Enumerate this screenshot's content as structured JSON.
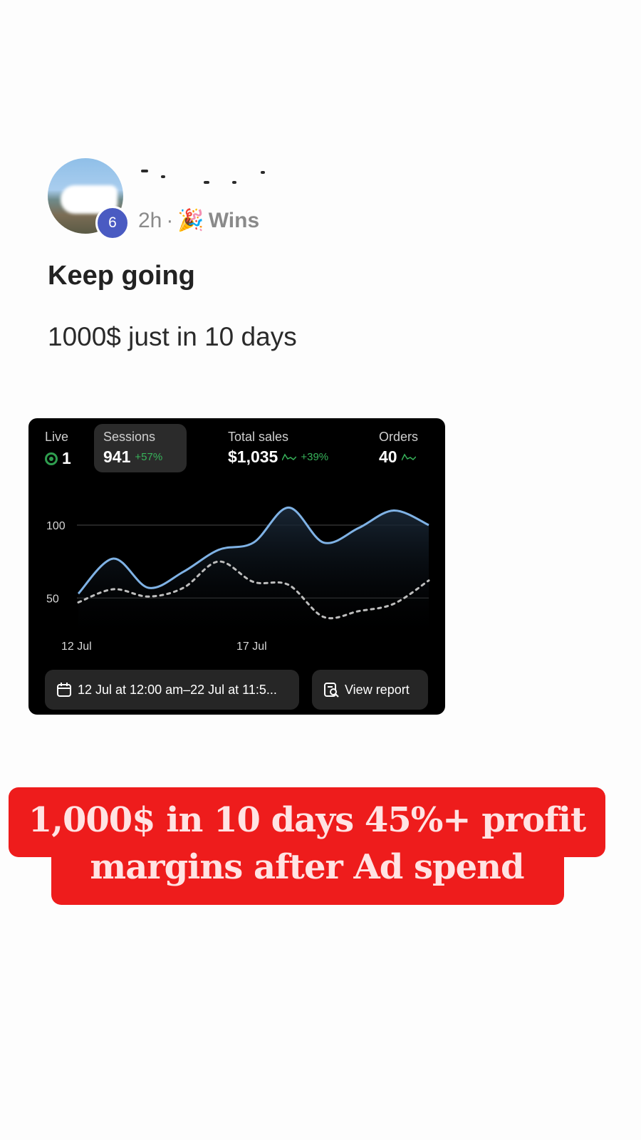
{
  "post": {
    "time": "2h",
    "separator": "·",
    "category_emoji": "🎉",
    "category": "Wins",
    "level": "6",
    "title": "Keep going",
    "body": "1000$ just in 10 days"
  },
  "dashboard": {
    "live": {
      "label": "Live",
      "value": "1"
    },
    "sessions": {
      "label": "Sessions",
      "value": "941",
      "change": "+57%"
    },
    "total_sales": {
      "label": "Total sales",
      "value": "$1,035",
      "change": "+39%"
    },
    "orders": {
      "label": "Orders",
      "value": "40"
    },
    "date_range": "12 Jul at 12:00 am–22 Jul at 11:5...",
    "view_report": "View report",
    "colors": {
      "current": "#7fb2e5",
      "previous": "#bdbdbd",
      "positive": "#37b35a"
    }
  },
  "chart_data": {
    "type": "line",
    "x_ticks": [
      "12 Jul",
      "17 Jul"
    ],
    "y_ticks": [
      50,
      100
    ],
    "series": [
      {
        "values": [
          53,
          77,
          57,
          68,
          83,
          88,
          112,
          88,
          98,
          110,
          100
        ]
      },
      {
        "values": [
          47,
          56,
          51,
          57,
          75,
          61,
          59,
          37,
          41,
          46,
          62
        ]
      }
    ],
    "ylim": [
      35,
      120
    ],
    "grid": true
  },
  "caption": {
    "line1": "1,000$ in 10 days 45%+ profit",
    "line2": "margins after Ad spend"
  }
}
